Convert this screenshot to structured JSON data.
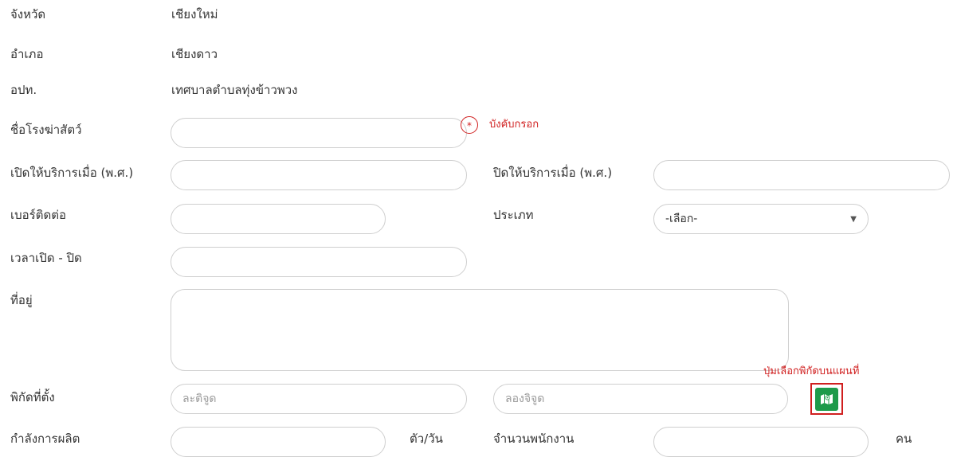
{
  "info": {
    "province_label": "จังหวัด",
    "province_value": "เชียงใหม่",
    "district_label": "อำเภอ",
    "district_value": "เชียงดาว",
    "lao_label": "อปท.",
    "lao_value": "เทศบาลตำบลทุ่งข้าวพวง"
  },
  "form": {
    "slaughterhouse_name_label": "ชื่อโรงฆ่าสัตว์",
    "slaughterhouse_name_value": "",
    "required_mark": "*",
    "required_note": "บังคับกรอก",
    "open_year_label": "เปิดให้บริการเมื่อ (พ.ศ.)",
    "open_year_value": "",
    "close_year_label": "ปิดให้บริการเมื่อ (พ.ศ.)",
    "close_year_value": "",
    "phone_label": "เบอร์ติดต่อ",
    "phone_value": "",
    "type_label": "ประเภท",
    "type_selected": "-เลือก-",
    "hours_label": "เวลาเปิด - ปิด",
    "hours_value": "",
    "address_label": "ที่อยู่",
    "address_value": "",
    "location_label": "พิกัดที่ตั้ง",
    "latitude_placeholder": "ละติจูด",
    "longitude_placeholder": "ลองจิจูด",
    "map_button_note": "ปุ่มเลือกพิกัดบนแผนที่",
    "capacity_label": "กำลังการผลิต",
    "capacity_value": "",
    "capacity_unit": "ตัว/วัน",
    "staff_label": "จำนวนพนักงาน",
    "staff_value": "",
    "staff_unit": "คน"
  },
  "icons": {
    "map_button": "map-marker-icon",
    "select_caret": "caret-down-icon"
  },
  "colors": {
    "required_red": "#d01f1f",
    "map_button_green": "#1e9a4a",
    "input_border": "#cfcfcf"
  }
}
